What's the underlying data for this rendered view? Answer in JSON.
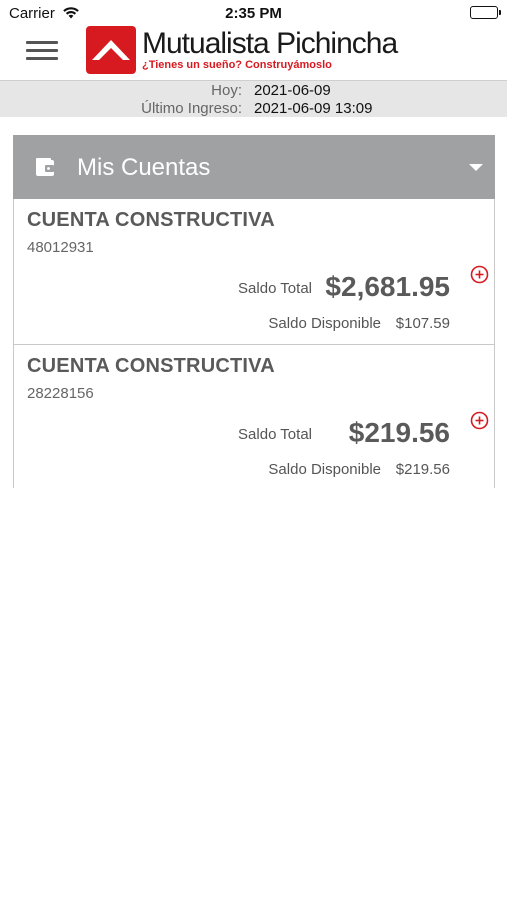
{
  "status_bar": {
    "carrier": "Carrier",
    "time": "2:35 PM",
    "wifi_icon": "wifi-icon",
    "battery_icon": "battery-icon"
  },
  "header": {
    "menu_icon": "hamburger-menu-icon",
    "brand_name": "Mutualista Pichincha",
    "brand_tagline": "¿Tienes un sueño? Construyámoslo",
    "brand_color": "#d71920"
  },
  "info": {
    "today_label": "Hoy:",
    "today_value": "2021-06-09",
    "last_login_label": "Último Ingreso:",
    "last_login_value": "2021-06-09 13:09"
  },
  "accounts_panel": {
    "title": "Mis Cuentas",
    "icon": "wallet-icon",
    "header_color": "#a0a1a3",
    "accounts": [
      {
        "name": "CUENTA CONSTRUCTIVA",
        "number": "48012931",
        "total_label": "Saldo Total",
        "total_value": "$2,681.95",
        "available_label": "Saldo Disponible",
        "available_value": "$107.59"
      },
      {
        "name": "CUENTA CONSTRUCTIVA",
        "number": "28228156",
        "total_label": "Saldo Total",
        "total_value": "$219.56",
        "available_label": "Saldo Disponible",
        "available_value": "$219.56"
      }
    ]
  }
}
